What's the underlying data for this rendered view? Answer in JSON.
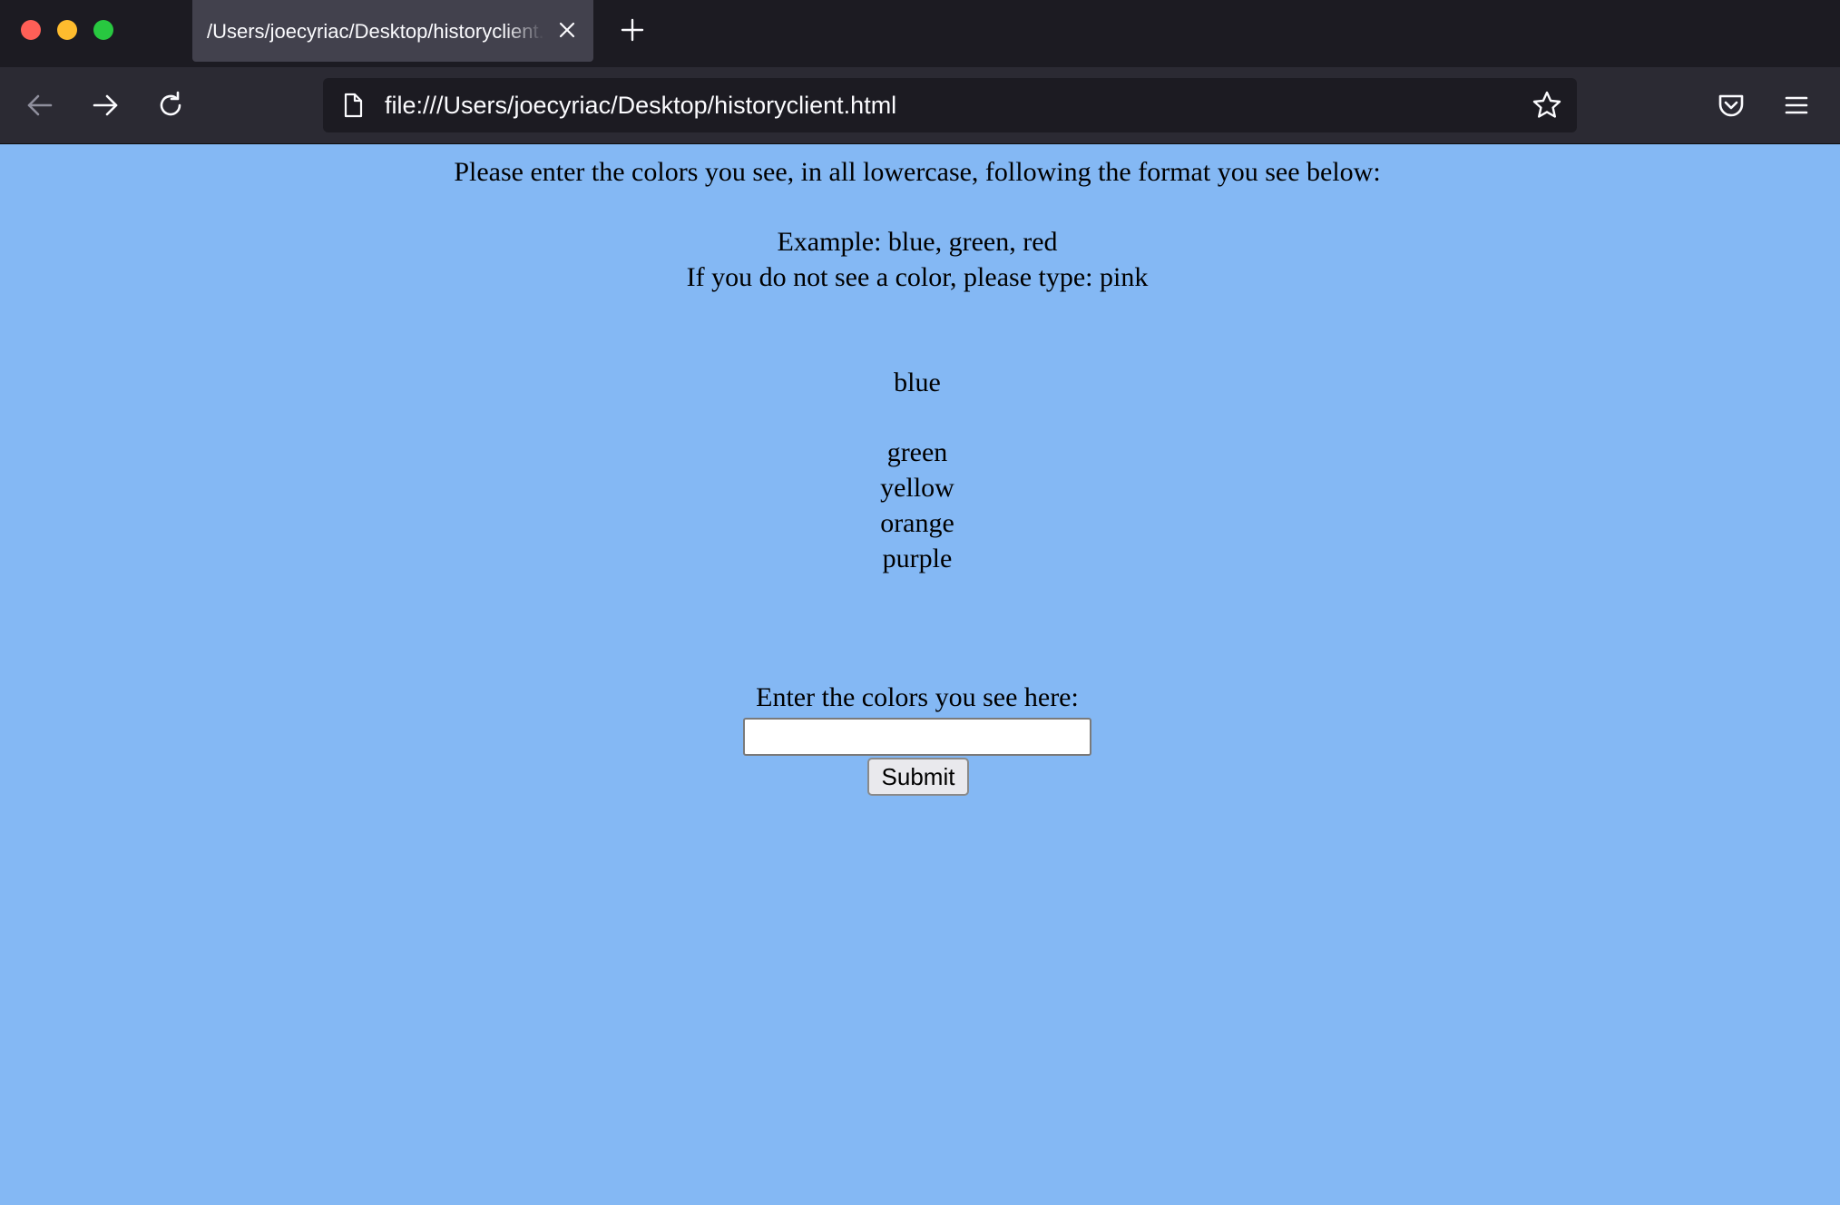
{
  "window": {
    "controls": [
      "close",
      "minimize",
      "maximize"
    ]
  },
  "tab": {
    "title": "/Users/joecyriac/Desktop/historyclient.html",
    "close_icon": "close-icon",
    "new_tab_icon": "plus-icon"
  },
  "navbar": {
    "back_icon": "arrow-left-icon",
    "forward_icon": "arrow-right-icon",
    "reload_icon": "reload-icon",
    "url": "file:///Users/joecyriac/Desktop/historyclient.html",
    "page_icon": "page-icon",
    "bookmark_icon": "star-icon",
    "pocket_icon": "pocket-icon",
    "menu_icon": "hamburger-menu-icon"
  },
  "page": {
    "background": "#84b8f4",
    "instruction": "Please enter the colors you see, in all lowercase, following the format you see below:",
    "example": "Example: blue, green, red",
    "no_color_hint": "If you do not see a color, please type: pink",
    "colors": [
      "blue",
      "green",
      "yellow",
      "orange",
      "purple"
    ],
    "input_label": "Enter the colors you see here:",
    "input_value": "",
    "submit_label": "Submit"
  }
}
